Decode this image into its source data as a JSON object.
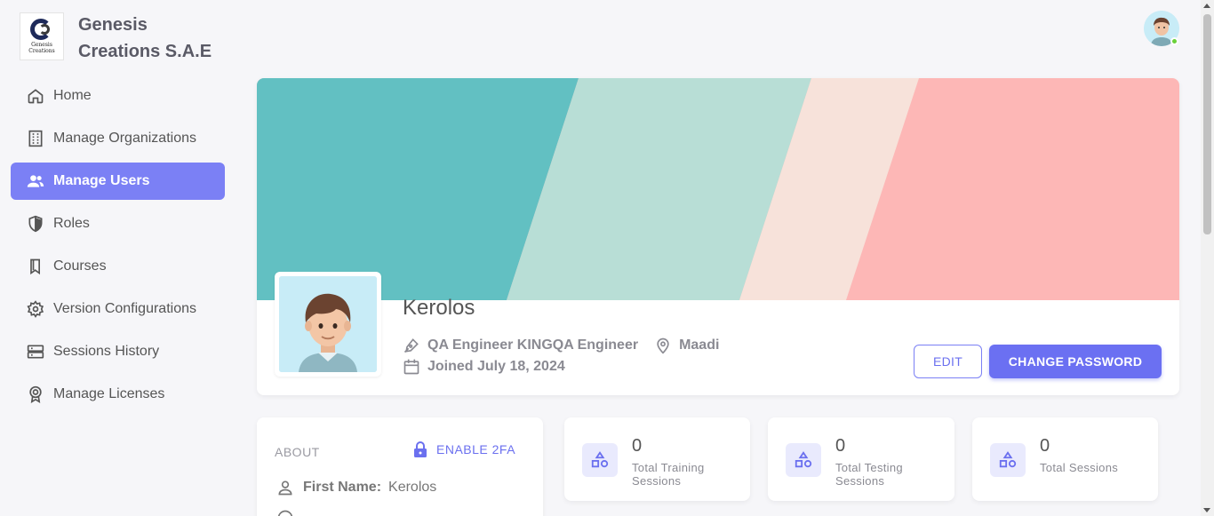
{
  "brand": {
    "logo_text_line1": "Genesis",
    "logo_text_line2": "Creations",
    "name": "Genesis Creations S.A.E"
  },
  "nav": {
    "items": [
      {
        "label": "Home",
        "icon": "home-icon"
      },
      {
        "label": "Manage Organizations",
        "icon": "building-icon"
      },
      {
        "label": "Manage Users",
        "icon": "users-icon",
        "active": true
      },
      {
        "label": "Roles",
        "icon": "shield-icon"
      },
      {
        "label": "Courses",
        "icon": "bookmark-icon"
      },
      {
        "label": "Version Configurations",
        "icon": "gear-icon"
      },
      {
        "label": "Sessions History",
        "icon": "server-icon"
      },
      {
        "label": "Manage Licenses",
        "icon": "badge-icon"
      }
    ]
  },
  "colors": {
    "accent": "#7b80f5",
    "button": "#6b70f2",
    "banner": [
      "#62c0c2",
      "#b8ded6",
      "#f7e2da",
      "#fdb7b6"
    ],
    "online": "#6ad13a"
  },
  "profile": {
    "name": "Kerolos",
    "title": "QA Engineer KINGQA Engineer",
    "location": "Maadi",
    "joined": "Joined July 18, 2024",
    "edit_label": "EDIT",
    "change_password_label": "CHANGE PASSWORD"
  },
  "about": {
    "title": "ABOUT",
    "enable_2fa_label": "ENABLE 2FA",
    "first_name_label": "First Name:",
    "first_name_value": "Kerolos"
  },
  "stats": [
    {
      "value": "0",
      "label": "Total Training Sessions"
    },
    {
      "value": "0",
      "label": "Total Testing Sessions"
    },
    {
      "value": "0",
      "label": "Total Sessions"
    }
  ]
}
